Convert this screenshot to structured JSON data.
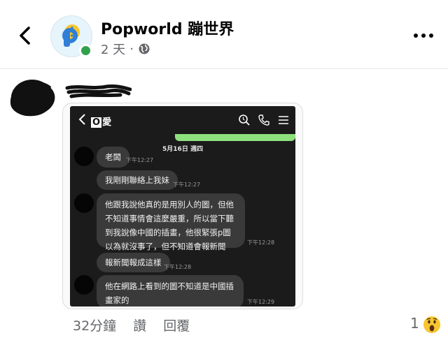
{
  "header": {
    "page_name": "Popworld 蹦世界",
    "time_ago": "2 天",
    "separator": "·",
    "privacy_icon": "globe-icon"
  },
  "comment": {
    "chat": {
      "contact_name": "愛",
      "contact_name_prefix": "O",
      "date": "5月16日 週四",
      "messages": [
        {
          "text": "老闆",
          "time": "下午12:27"
        },
        {
          "text": "我剛剛聯絡上我妹",
          "time": "下午12:27"
        },
        {
          "text": "他跟我說他真的是用別人的圖，但他不知道事情會這麼嚴重，所以當下聽到我說像中國的插畫，他很緊張p圖以為就沒事了，但不知道會報新聞",
          "time": "下午12:28"
        },
        {
          "text": "報新聞報成這樣",
          "time": "下午12:28"
        },
        {
          "text": "他在網路上看到的圖不知道是中國插畫家的",
          "time": "下午12:29"
        }
      ]
    },
    "actions": {
      "time": "32分鐘",
      "like": "讚",
      "reply": "回覆"
    },
    "reactions": {
      "count": "1",
      "type": "wow"
    }
  },
  "colors": {
    "online": "#31a24c",
    "chat_bg": "#1b1b1b",
    "bubble_bg": "#3a3a3a",
    "sent_bubble": "#8ee07d",
    "meta_text": "#65676b"
  }
}
